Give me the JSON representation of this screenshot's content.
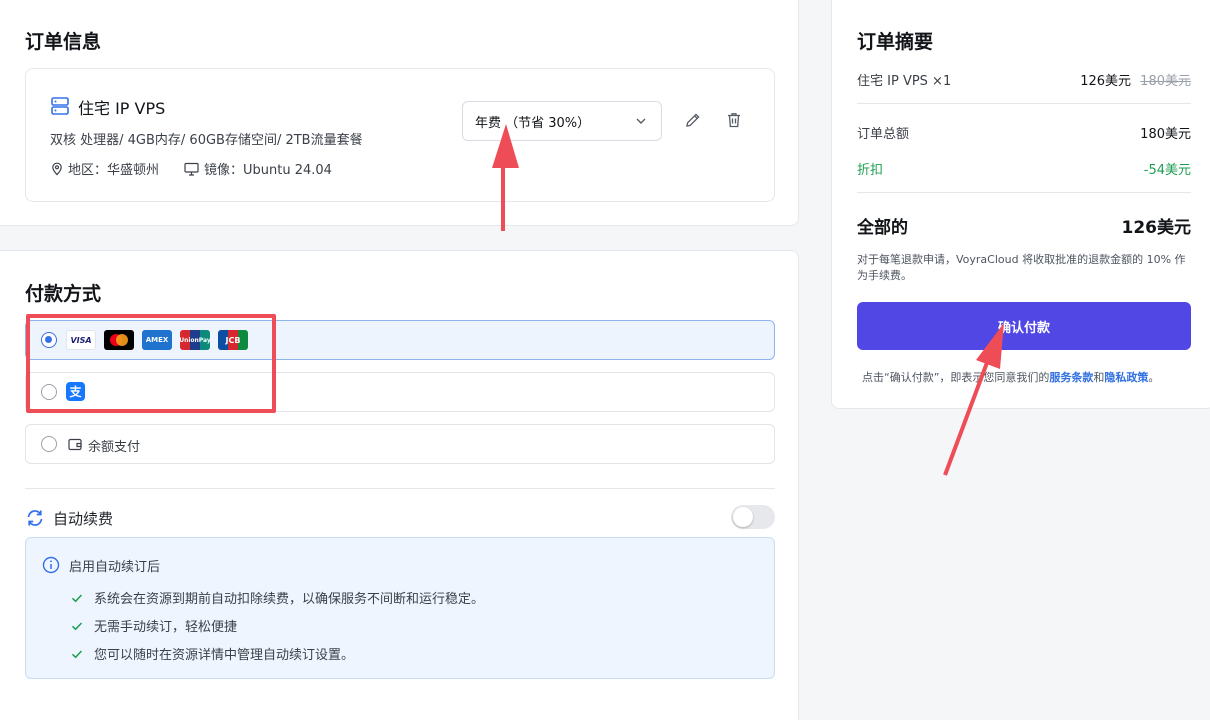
{
  "order": {
    "title": "订单信息",
    "item": {
      "name": "住宅 IP VPS",
      "specs": "双核 处理器/ 4GB内存/ 60GB存储空间/ 2TB流量套餐",
      "region": "地区：华盛顿州",
      "image": "镜像：Ubuntu 24.04",
      "icon": "server-icon"
    },
    "billing": {
      "selected": "年费 （节省 30%）"
    }
  },
  "payment": {
    "title": "付款方式",
    "cards": [
      "VISA",
      "Mastercard",
      "American Express",
      "UnionPay",
      "JCB"
    ],
    "alipay_glyph": "支",
    "balance_label": "余额支付",
    "selected": "card"
  },
  "auto_renew": {
    "label": "自动续费",
    "enabled": false,
    "info_title": "启用自动续订后",
    "items": [
      "系统会在资源到期前自动扣除续费，以确保服务不间断和运行稳定。",
      "无需手动续订，轻松便捷",
      "您可以随时在资源详情中管理自动续订设置。"
    ]
  },
  "summary": {
    "title": "订单摘要",
    "line_item": "住宅 IP VPS ×1",
    "line_price": "126美元",
    "line_original": "180美元",
    "subtotal_label": "订单总额",
    "subtotal_value": "180美元",
    "discount_label": "折扣",
    "discount_value": "-54美元",
    "total_label": "全部的",
    "total_value": "126美元",
    "refund_note": "对于每笔退款申请，VoyraCloud 将收取批准的退款金额的 10% 作为手续费。",
    "confirm_label": "确认付款",
    "agree_prefix": "点击“确认付款”，即表示您同意我们的",
    "terms_link": "服务条款",
    "and": "和",
    "privacy_link": "隐私政策",
    "period": "。"
  },
  "colors": {
    "accent": "#5147e5",
    "link": "#2f6fe0",
    "discount": "#1e9e52",
    "annotation": "#ee4d58"
  }
}
